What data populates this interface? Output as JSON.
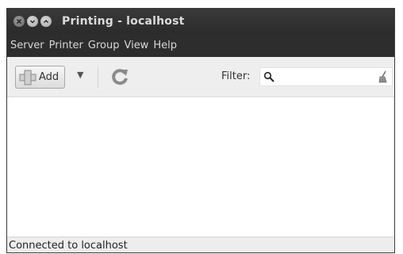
{
  "window": {
    "title": "Printing - localhost",
    "controls": [
      "close-icon",
      "minimize-icon",
      "maximize-icon"
    ]
  },
  "menubar": {
    "items": [
      {
        "label": "Server"
      },
      {
        "label": "Printer"
      },
      {
        "label": "Group"
      },
      {
        "label": "View"
      },
      {
        "label": "Help"
      }
    ]
  },
  "toolbar": {
    "add_label": "Add",
    "add_icon": "add-printer-icon",
    "dropdown_icon": "dropdown-arrow-icon",
    "refresh_icon": "refresh-icon",
    "filter_label": "Filter:",
    "filter_value": "",
    "filter_search_icon": "search-icon",
    "filter_clear_icon": "clear-icon"
  },
  "status": {
    "text": "Connected to localhost"
  },
  "colors": {
    "titlebar": "#2b2b2b",
    "menubar": "#2d2d2d",
    "toolbar": "#eeeeee",
    "refresh_accent": "#7a7a7a"
  }
}
